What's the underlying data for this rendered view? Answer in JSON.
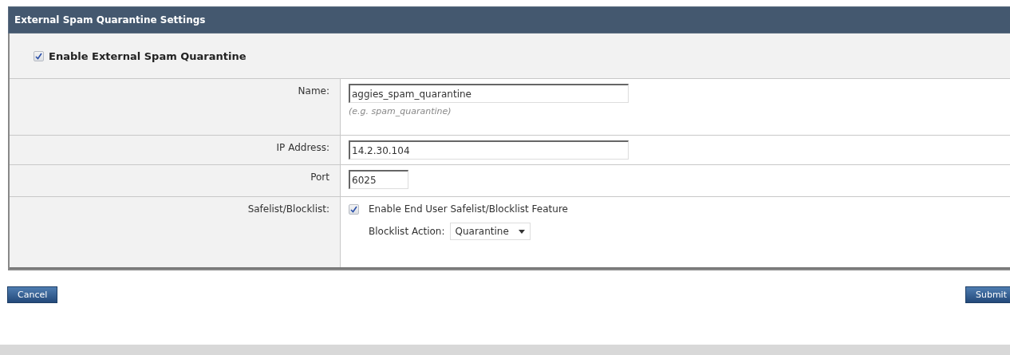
{
  "panel": {
    "title": "External Spam Quarantine Settings",
    "enable": {
      "label": "Enable External Spam Quarantine",
      "checked": true
    },
    "rows": [
      {
        "kind": "text",
        "label": "Name:",
        "value": "aggies_spam_quarantine",
        "hint": "(e.g. spam_quarantine)"
      },
      {
        "kind": "text",
        "label": "IP Address:",
        "value": "14.2.30.104"
      },
      {
        "kind": "number",
        "label": "Port",
        "value": "6025"
      },
      {
        "kind": "safelist",
        "label": "Safelist/Blocklist:",
        "option": {
          "label": "Enable End User Safelist/Blocklist Feature",
          "checked": true
        },
        "action_label": "Blocklist Action:",
        "action_value": "Quarantine"
      }
    ]
  },
  "buttons": [
    {
      "label": "Cancel"
    },
    {
      "label": "Submit"
    }
  ]
}
